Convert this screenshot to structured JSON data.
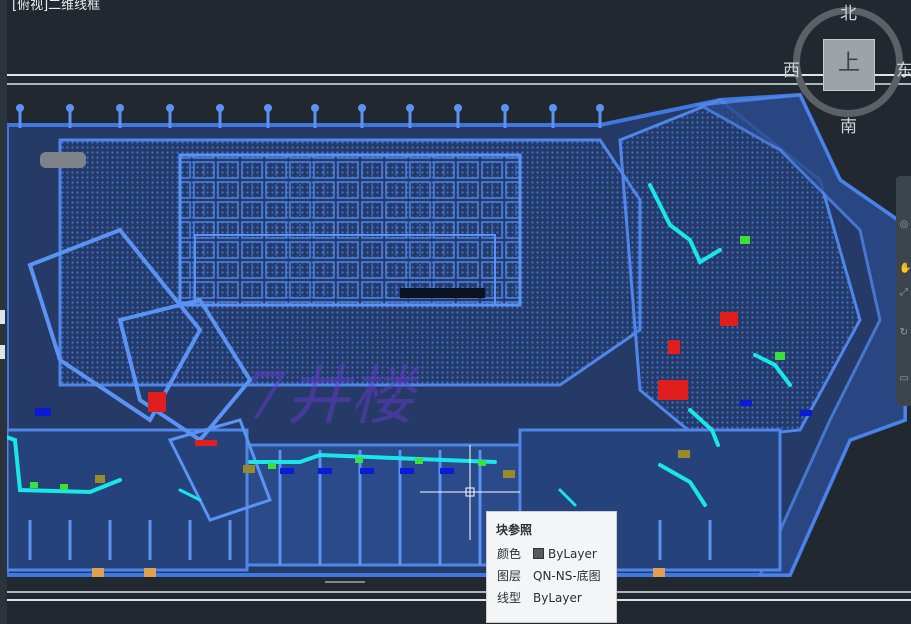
{
  "viewport": {
    "title": "[俯视]二维线框"
  },
  "drawing": {
    "watermark": "7井楼"
  },
  "viewcube": {
    "face": "上",
    "north": "北",
    "south": "南",
    "west": "西",
    "east": "东"
  },
  "tooltip": {
    "title": "块参照",
    "rows": [
      {
        "key": "颜色",
        "value": "ByLayer",
        "swatch": "#555b61"
      },
      {
        "key": "图层",
        "value": "QN-NS-底图"
      },
      {
        "key": "线型",
        "value": "ByLayer"
      }
    ]
  },
  "colors": {
    "background": "#212830",
    "drawing_primary": "#3f78e0",
    "highlight_cyan": "#19e6e6",
    "highlight_red": "#e01e1e",
    "highlight_green": "#3ce03c",
    "crosshair": "#ffffff"
  }
}
